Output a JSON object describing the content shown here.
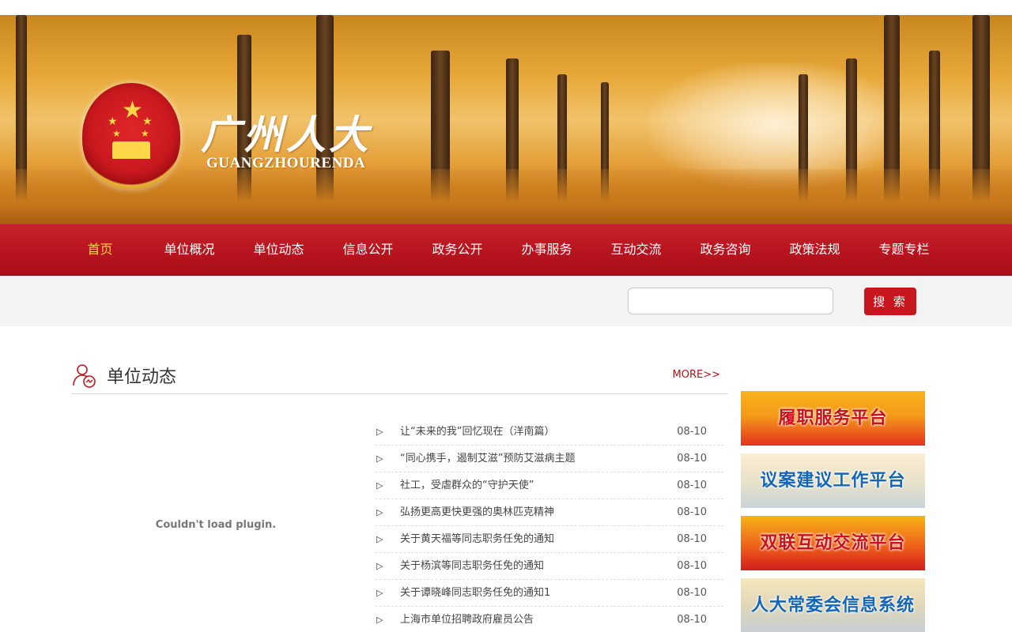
{
  "header": {
    "logo_cn": "广州人大",
    "logo_en": "GUANGZHOURENDA"
  },
  "nav": {
    "items": [
      {
        "label": "首页",
        "active": true
      },
      {
        "label": "单位概况"
      },
      {
        "label": "单位动态"
      },
      {
        "label": "信息公开"
      },
      {
        "label": "政务公开"
      },
      {
        "label": "办事服务"
      },
      {
        "label": "互动交流"
      },
      {
        "label": "政务咨询"
      },
      {
        "label": "政策法规"
      },
      {
        "label": "专题专栏"
      }
    ]
  },
  "search": {
    "placeholder": "",
    "button_label": "搜 索"
  },
  "section": {
    "title": "单位动态",
    "more_label": "MORE>>"
  },
  "plugin": {
    "message": "Couldn't load plugin."
  },
  "news": [
    {
      "title": "让“未来的我”回忆现在（洋南篇）",
      "date": "08-10"
    },
    {
      "title": "“同心携手，遏制艾滋”预防艾滋病主题",
      "date": "08-10"
    },
    {
      "title": "社工，受虐群众的“守护天使”",
      "date": "08-10"
    },
    {
      "title": "弘扬更高更快更强的奥林匹克精神",
      "date": "08-10"
    },
    {
      "title": "关于黄天福等同志职务任免的通知",
      "date": "08-10"
    },
    {
      "title": "关于杨滨等同志职务任免的通知",
      "date": "08-10"
    },
    {
      "title": "关于谭晓峰同志职务任免的通知1",
      "date": "08-10"
    },
    {
      "title": "上海市单位招聘政府雇员公告",
      "date": "08-10"
    }
  ],
  "sidebar": {
    "banners": [
      {
        "label": "履职服务平台"
      },
      {
        "label": "议案建议工作平台"
      },
      {
        "label": "双联互动交流平台"
      },
      {
        "label": "人大常委会信息系统"
      }
    ]
  },
  "colors": {
    "nav_red": "#b8151f",
    "active_nav": "#ffd34a",
    "more_link": "#b0121a",
    "search_button": "#c8161e"
  }
}
